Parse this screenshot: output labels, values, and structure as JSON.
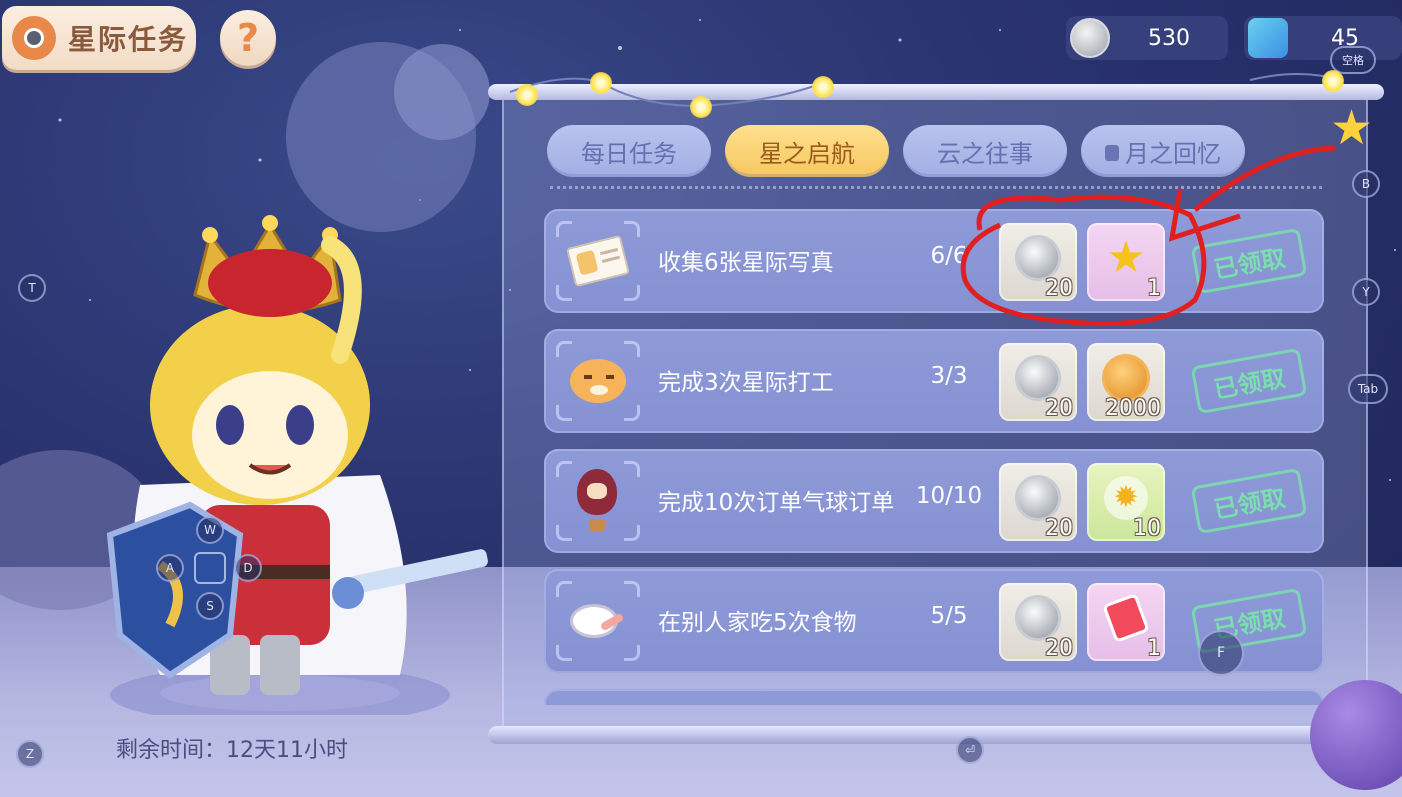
{
  "header": {
    "title": "星际任务",
    "help_label": "?"
  },
  "currencies": {
    "coins": "530",
    "gems": "45"
  },
  "key_hints": {
    "space": "空格",
    "b": "B",
    "y": "Y",
    "tab": "Tab",
    "t": "T",
    "z": "Z",
    "f": "F",
    "enter": "⏎",
    "w": "W",
    "a": "A",
    "s": "S",
    "d": "D"
  },
  "tabs": [
    {
      "label": "每日任务",
      "active": false
    },
    {
      "label": "星之启航",
      "active": true
    },
    {
      "label": "云之往事",
      "active": false
    },
    {
      "label": "月之回忆",
      "active": false,
      "locked": true
    }
  ],
  "tasks": [
    {
      "name": "收集6张星际写真",
      "progress": "6/6",
      "icon": "photo-card-icon",
      "reward1": "20",
      "reward2": "1",
      "reward2_icon": "gold-star-icon",
      "status": "已领取"
    },
    {
      "name": "完成3次星际打工",
      "progress": "3/3",
      "icon": "cat-face-icon",
      "reward1": "20",
      "reward2": "2000",
      "reward2_icon": "bronze-coin-icon",
      "status": "已领取"
    },
    {
      "name": "完成10次订单气球订单",
      "progress": "10/10",
      "icon": "hot-air-balloon-icon",
      "reward1": "20",
      "reward2": "10",
      "reward2_icon": "sun-badge-icon",
      "status": "已领取"
    },
    {
      "name": "在别人家吃5次食物",
      "progress": "5/5",
      "icon": "dish-icon",
      "reward1": "20",
      "reward2": "1",
      "reward2_icon": "food-card-icon",
      "status": "已领取"
    }
  ],
  "timer": "剩余时间：12天11小时",
  "colors": {
    "accent_tab": "#f7c760",
    "annotation": "#e02020",
    "claimed_stamp": "#78e6aa"
  }
}
